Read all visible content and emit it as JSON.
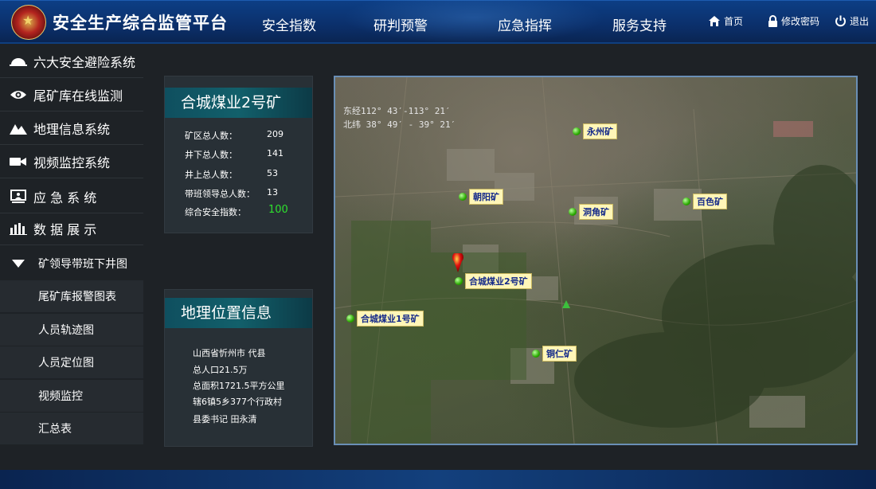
{
  "header": {
    "title": "安全生产综合监管平台",
    "nav": [
      "安全指数",
      "研判预警",
      "应急指挥",
      "服务支持"
    ],
    "home_label": "首页",
    "password_label": "修改密码",
    "logout_label": "退出"
  },
  "sidebar": {
    "main_items": [
      {
        "label": "六大安全避险系统",
        "icon": "helmet-icon"
      },
      {
        "label": "尾矿库在线监测",
        "icon": "eye-icon"
      },
      {
        "label": "地理信息系统",
        "icon": "mountain-icon"
      },
      {
        "label": "视频监控系统",
        "icon": "video-camera-icon"
      },
      {
        "label": "应 急 系 统",
        "icon": "monitor-user-icon"
      },
      {
        "label": "数 据 展 示",
        "icon": "bar-chart-icon"
      }
    ],
    "expanded_label": "矿领导带班下井图",
    "sub_items": [
      "尾矿库报警图表",
      "人员轨迹图",
      "人员定位图",
      "视频监控",
      "汇总表"
    ]
  },
  "mine_panel": {
    "title": "合城煤业2号矿",
    "stats": [
      {
        "label": "矿区总人数：",
        "value": "209"
      },
      {
        "label": "井下总人数：",
        "value": "141"
      },
      {
        "label": "井上总人数：",
        "value": "53"
      },
      {
        "label": "带班领导总人数：",
        "value": "13"
      },
      {
        "label": "综合安全指数：",
        "value": "100"
      }
    ],
    "index_color": "#2ee02e"
  },
  "location_panel": {
    "title": "地理位置信息",
    "lines": [
      "山西省忻州市 代县",
      "总人口21.5万",
      "总面积1721.5平方公里",
      "辖6镇5乡377个行政村",
      "县委书记 田永清"
    ]
  },
  "map": {
    "lon_text": "东经112° 43′-113° 21′",
    "lat_text": "北纬 38° 49′ - 39° 21′",
    "markers": [
      "永州矿",
      "朝阳矿",
      "洞角矿",
      "百色矿",
      "合城煤业2号矿",
      "合城煤业1号矿",
      "铜仁矿"
    ]
  },
  "colors": {
    "header_bg": "#0b2f6a",
    "body_bg": "#1e2226",
    "label_bg": "#fff6b8",
    "label_text": "#142a8a",
    "marker_green": "#2aa800",
    "pin_red": "#e01010"
  }
}
